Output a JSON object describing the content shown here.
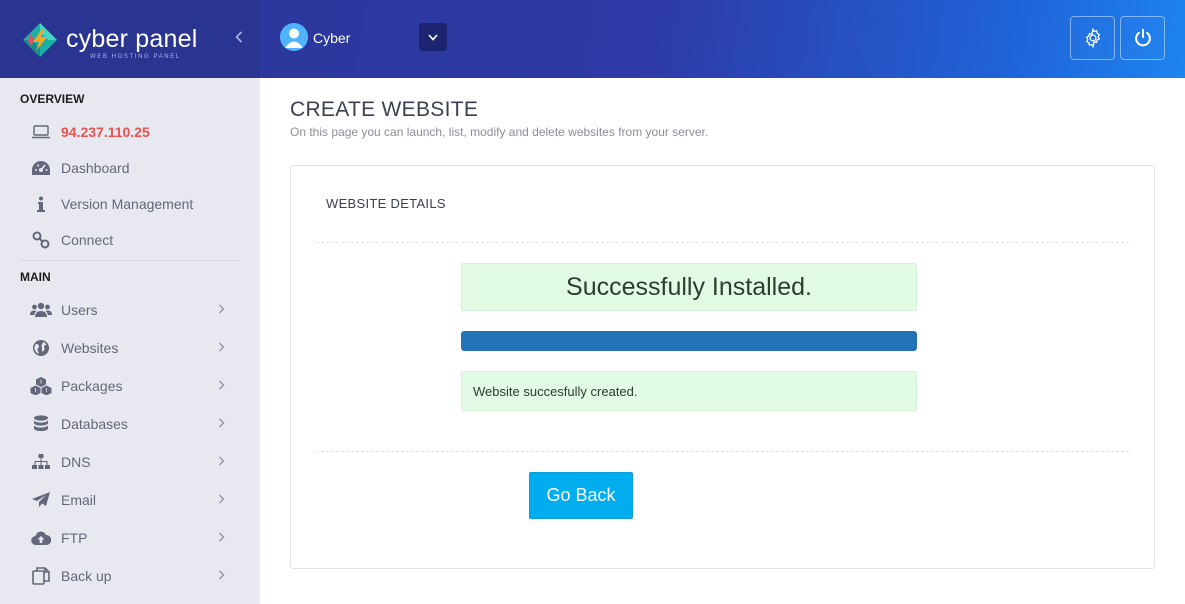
{
  "brand": {
    "name": "cyber panel",
    "tagline": "WEB HOSTING PANEL"
  },
  "header": {
    "user_name": "Cyber",
    "icons": {
      "collapse": "chevron-left-icon",
      "user_dropdown": "chevron-down-icon",
      "settings": "gear-icon",
      "power": "power-icon"
    }
  },
  "sidebar": {
    "overview_heading": "OVERVIEW",
    "main_heading": "MAIN",
    "overview_items": [
      {
        "label": "94.237.110.25",
        "icon": "laptop-icon"
      },
      {
        "label": "Dashboard",
        "icon": "dashboard-icon"
      },
      {
        "label": "Version Management",
        "icon": "info-icon"
      },
      {
        "label": "Connect",
        "icon": "link-icon"
      }
    ],
    "main_items": [
      {
        "label": "Users",
        "icon": "users-icon"
      },
      {
        "label": "Websites",
        "icon": "globe-icon"
      },
      {
        "label": "Packages",
        "icon": "cubes-icon"
      },
      {
        "label": "Databases",
        "icon": "database-icon"
      },
      {
        "label": "DNS",
        "icon": "sitemap-icon"
      },
      {
        "label": "Email",
        "icon": "paper-plane-icon"
      },
      {
        "label": "FTP",
        "icon": "cloud-upload-icon"
      },
      {
        "label": "Back up",
        "icon": "copy-icon"
      }
    ]
  },
  "main": {
    "title": "CREATE WEBSITE",
    "description": "On this page you can launch, list, modify and delete websites from your server.",
    "panel": {
      "title": "WEBSITE DETAILS",
      "status_text": "Successfully Installed.",
      "progress_percent": 100,
      "message": "Website succesfully created.",
      "go_back_label": "Go Back"
    }
  },
  "colors": {
    "header_start": "#2b3697",
    "header_end": "#1e84f0",
    "ip_text": "#e9524f",
    "progress_fill": "#2273b5",
    "success_bg": "#e2fbe5",
    "button": "#00aef0"
  }
}
